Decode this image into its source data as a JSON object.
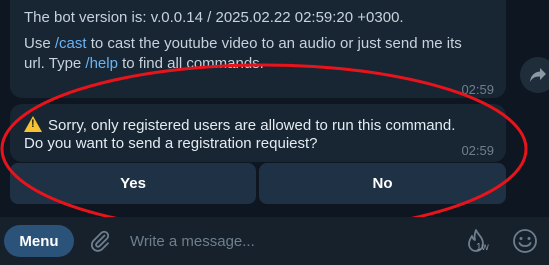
{
  "messages": {
    "bot_info": {
      "version_line": "The bot version is: v.0.0.14 / 2025.02.22 02:59:20 +0300.",
      "use_prefix": "Use ",
      "cast_command": "/cast",
      "use_suffix": " to cast the youtube video to an audio or just send me its",
      "type_prefix": "url. Type ",
      "help_command": "/help",
      "type_suffix": " to find all commands.",
      "time": "02:59"
    },
    "registration_notice": {
      "line1": "Sorry, only registered users are allowed to run this command.",
      "line2": "Do you want to send a registration requiest?",
      "time": "02:59",
      "icon": "warning-icon"
    }
  },
  "inline_keyboard": {
    "yes_label": "Yes",
    "no_label": "No"
  },
  "composer": {
    "menu_label": "Menu",
    "input_placeholder": "Write a message...",
    "boost_label": "1w"
  },
  "colors": {
    "background": "#0e1621",
    "bubble": "#182533",
    "link": "#6ab3f3",
    "button": "#1f3144",
    "menu_button": "#2b5278",
    "annotation": "#e8141b"
  }
}
